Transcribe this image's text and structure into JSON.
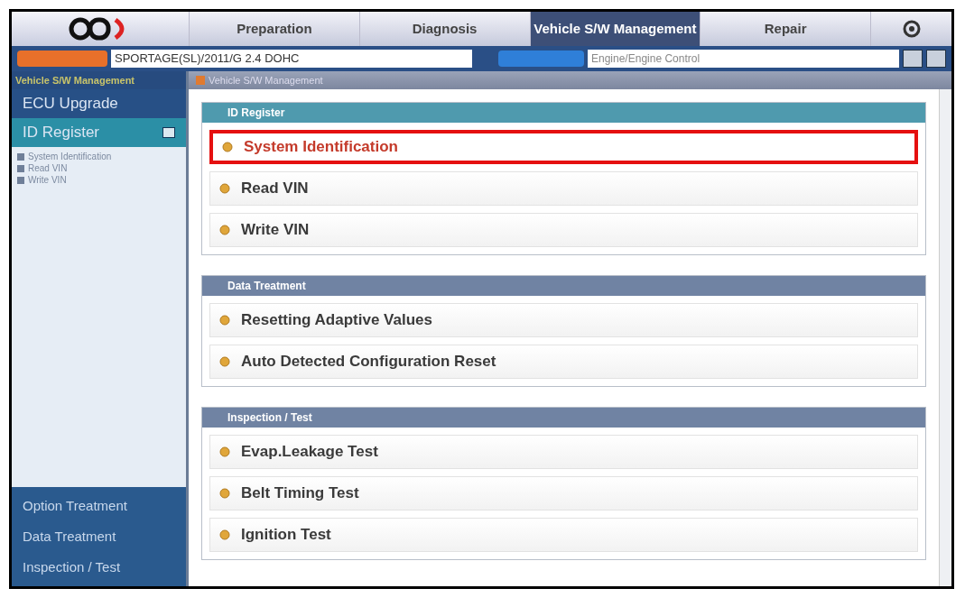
{
  "nav": {
    "tabs": [
      {
        "label": "Preparation",
        "selected": false
      },
      {
        "label": "Diagnosis",
        "selected": false
      },
      {
        "label": "Vehicle S/W Management",
        "selected": true
      },
      {
        "label": "Repair",
        "selected": false
      }
    ]
  },
  "vehicle_bar": {
    "vehicle": "SPORTAGE(SL)/2011/G 2.4 DOHC",
    "system": "Engine/Engine Control"
  },
  "sidebar": {
    "title": "Vehicle S/W Management",
    "items": [
      {
        "label": "ECU Upgrade",
        "selected": false
      },
      {
        "label": "ID Register",
        "selected": true,
        "children": [
          {
            "label": "System Identification"
          },
          {
            "label": "Read VIN"
          },
          {
            "label": "Write VIN"
          }
        ]
      }
    ],
    "bottom_items": [
      {
        "label": "Option Treatment"
      },
      {
        "label": "Data Treatment"
      },
      {
        "label": "Inspection / Test"
      }
    ]
  },
  "content": {
    "title": "Vehicle S/W Management",
    "sections": [
      {
        "title": "ID Register",
        "kind": "teal",
        "items": [
          {
            "label": "System Identification",
            "selected": true
          },
          {
            "label": "Read VIN",
            "selected": false
          },
          {
            "label": "Write VIN",
            "selected": false
          }
        ]
      },
      {
        "title": "Data Treatment",
        "kind": "slate",
        "items": [
          {
            "label": "Resetting Adaptive Values",
            "selected": false
          },
          {
            "label": "Auto Detected Configuration Reset",
            "selected": false
          }
        ]
      },
      {
        "title": "Inspection / Test",
        "kind": "slate",
        "items": [
          {
            "label": "Evap.Leakage Test",
            "selected": false
          },
          {
            "label": "Belt Timing Test",
            "selected": false
          },
          {
            "label": "Ignition Test",
            "selected": false
          }
        ]
      }
    ]
  }
}
